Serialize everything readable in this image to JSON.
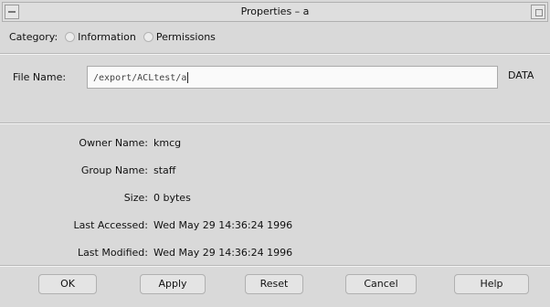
{
  "window": {
    "title": "Properties – a"
  },
  "category": {
    "label": "Category:",
    "options": [
      "Information",
      "Permissions"
    ]
  },
  "file": {
    "label": "File Name:",
    "value": "/export/ACLtest/a",
    "right_label": "DATA"
  },
  "info": [
    {
      "key": "Owner Name:",
      "value": "kmcg"
    },
    {
      "key": "Group Name:",
      "value": "staff"
    },
    {
      "key": "Size:",
      "value": "0 bytes"
    },
    {
      "key": "Last Accessed:",
      "value": "Wed May 29 14:36:24 1996"
    },
    {
      "key": "Last Modified:",
      "value": "Wed May 29 14:36:24 1996"
    }
  ],
  "buttons": {
    "ok": "OK",
    "apply": "Apply",
    "reset": "Reset",
    "cancel": "Cancel",
    "help": "Help"
  }
}
